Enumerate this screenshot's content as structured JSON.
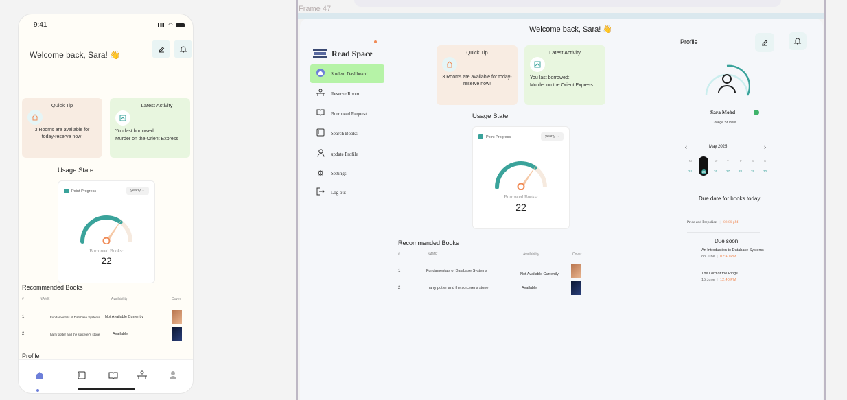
{
  "frame_label": "Frame 47",
  "mobile": {
    "status": {
      "time": "9:41"
    },
    "welcome": "Welcome back, Sara! 👋",
    "quick_tip": {
      "title": "Quick Tip",
      "text": "3 Rooms are available for today-reserve now!"
    },
    "latest_activity": {
      "title": "Latest Activity",
      "line1": "You last borrowed:",
      "line2": "Murder on the Orient Express"
    },
    "usage_title": "Usage State",
    "gauge": {
      "legend": "Point Progress",
      "period": "yearly",
      "label": "Borrowed Books:",
      "value": "22",
      "progress": 0.7
    },
    "recommended_title": "Recommended Books",
    "table": {
      "headers": [
        "#",
        "NAME",
        "Availability",
        "Cover"
      ],
      "rows": [
        {
          "num": "1",
          "name": "Fundamentals of Database Systems",
          "availability": "Not Available Currently"
        },
        {
          "num": "2",
          "name": "harry potter and the sorcerer's stone",
          "availability": "Available"
        }
      ]
    },
    "profile_title": "Profile"
  },
  "desktop": {
    "welcome": "Welcome back, Sara! 👋",
    "brand": "Read Space",
    "nav": [
      {
        "label": "Student Dashboard",
        "icon": "home-icon"
      },
      {
        "label": "Reserve Room",
        "icon": "desk-icon"
      },
      {
        "label": "Borrowed Request",
        "icon": "book-open-icon"
      },
      {
        "label": "Search Books",
        "icon": "search-book-icon"
      },
      {
        "label": "update Profile",
        "icon": "user-icon"
      },
      {
        "label": "Settings",
        "icon": "gear-icon"
      },
      {
        "label": "Log out",
        "icon": "logout-icon"
      }
    ],
    "quick_tip": {
      "title": "Quick Tip",
      "text": "3 Rooms are available for today-reserve now!"
    },
    "latest_activity": {
      "title": "Latest Activity",
      "line1": "You last borrowed:",
      "line2": "Murder on the Orient Express"
    },
    "usage_title": "Usage State",
    "gauge": {
      "legend": "Point Progress",
      "period": "yearly",
      "label": "Borrowed Books:",
      "value": "22",
      "progress": 0.7
    },
    "recommended_title": "Recommended Books",
    "table": {
      "headers": [
        "#",
        "NAME",
        "Availability",
        "Cover"
      ],
      "rows": [
        {
          "num": "1",
          "name": "Fundamentals of Database Systems",
          "availability": "Not Available Currently"
        },
        {
          "num": "2",
          "name": "harry potter and the sorcerer's stone",
          "availability": "Available"
        }
      ]
    },
    "profile": {
      "title": "Profile",
      "name": "Sara Mohd",
      "role": "College Student",
      "month": "May 2025",
      "weekdays": [
        "M",
        "T",
        "W",
        "T",
        "F",
        "S",
        "S"
      ],
      "dates": [
        "24",
        "25",
        "26",
        "27",
        "28",
        "29",
        "30"
      ],
      "due_today_title": "Due date for books today",
      "due_today": {
        "book": "Pride and Prejudice",
        "time": "08:00 pM"
      },
      "due_soon_title": "Due soon",
      "due_soon": [
        {
          "book": "An Introduction to Database Systems",
          "date": "on June",
          "time": "02:40 PM"
        },
        {
          "book": "The Lord of the Rings",
          "date": "15 June",
          "time": "12:40 PM"
        }
      ]
    }
  }
}
